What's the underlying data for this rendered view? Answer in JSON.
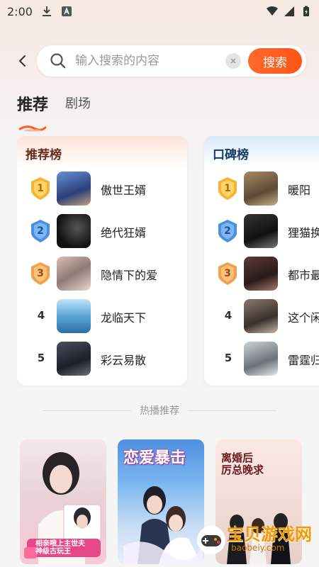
{
  "status_bar": {
    "time": "2:00"
  },
  "search": {
    "placeholder": "输入搜索的内容",
    "button_label": "搜索"
  },
  "tabs": [
    {
      "label": "推荐",
      "active": true
    },
    {
      "label": "剧场",
      "active": false
    }
  ],
  "rankings": [
    {
      "title": "推荐榜",
      "items": [
        {
          "rank": "1",
          "title": "傲世王婿"
        },
        {
          "rank": "2",
          "title": "绝代狂婿"
        },
        {
          "rank": "3",
          "title": "隐情下的爱"
        },
        {
          "rank": "4",
          "title": "龙临天下"
        },
        {
          "rank": "5",
          "title": "彩云易散"
        }
      ]
    },
    {
      "title": "口碑榜",
      "items": [
        {
          "rank": "1",
          "title": "暖阳"
        },
        {
          "rank": "2",
          "title": "狸猫换"
        },
        {
          "rank": "3",
          "title": "都市最"
        },
        {
          "rank": "4",
          "title": "这个闲"
        },
        {
          "rank": "5",
          "title": "雷霆归"
        }
      ]
    }
  ],
  "hot_section": {
    "title": "热播推荐"
  },
  "posters": [
    {
      "title": "相亲哦上主世夫\n神级古玩王"
    },
    {
      "title": "恋爱暴击"
    },
    {
      "title": "离婚后\n厉总晚求"
    }
  ],
  "watermark": {
    "text": "宝贝游戏网",
    "url": "baobeiy.com"
  },
  "colors": {
    "accent": "#ff5a1f",
    "gold_badge": "#f6b530",
    "blue_badge": "#4a90e2",
    "bronze_badge": "#f2a04a"
  }
}
